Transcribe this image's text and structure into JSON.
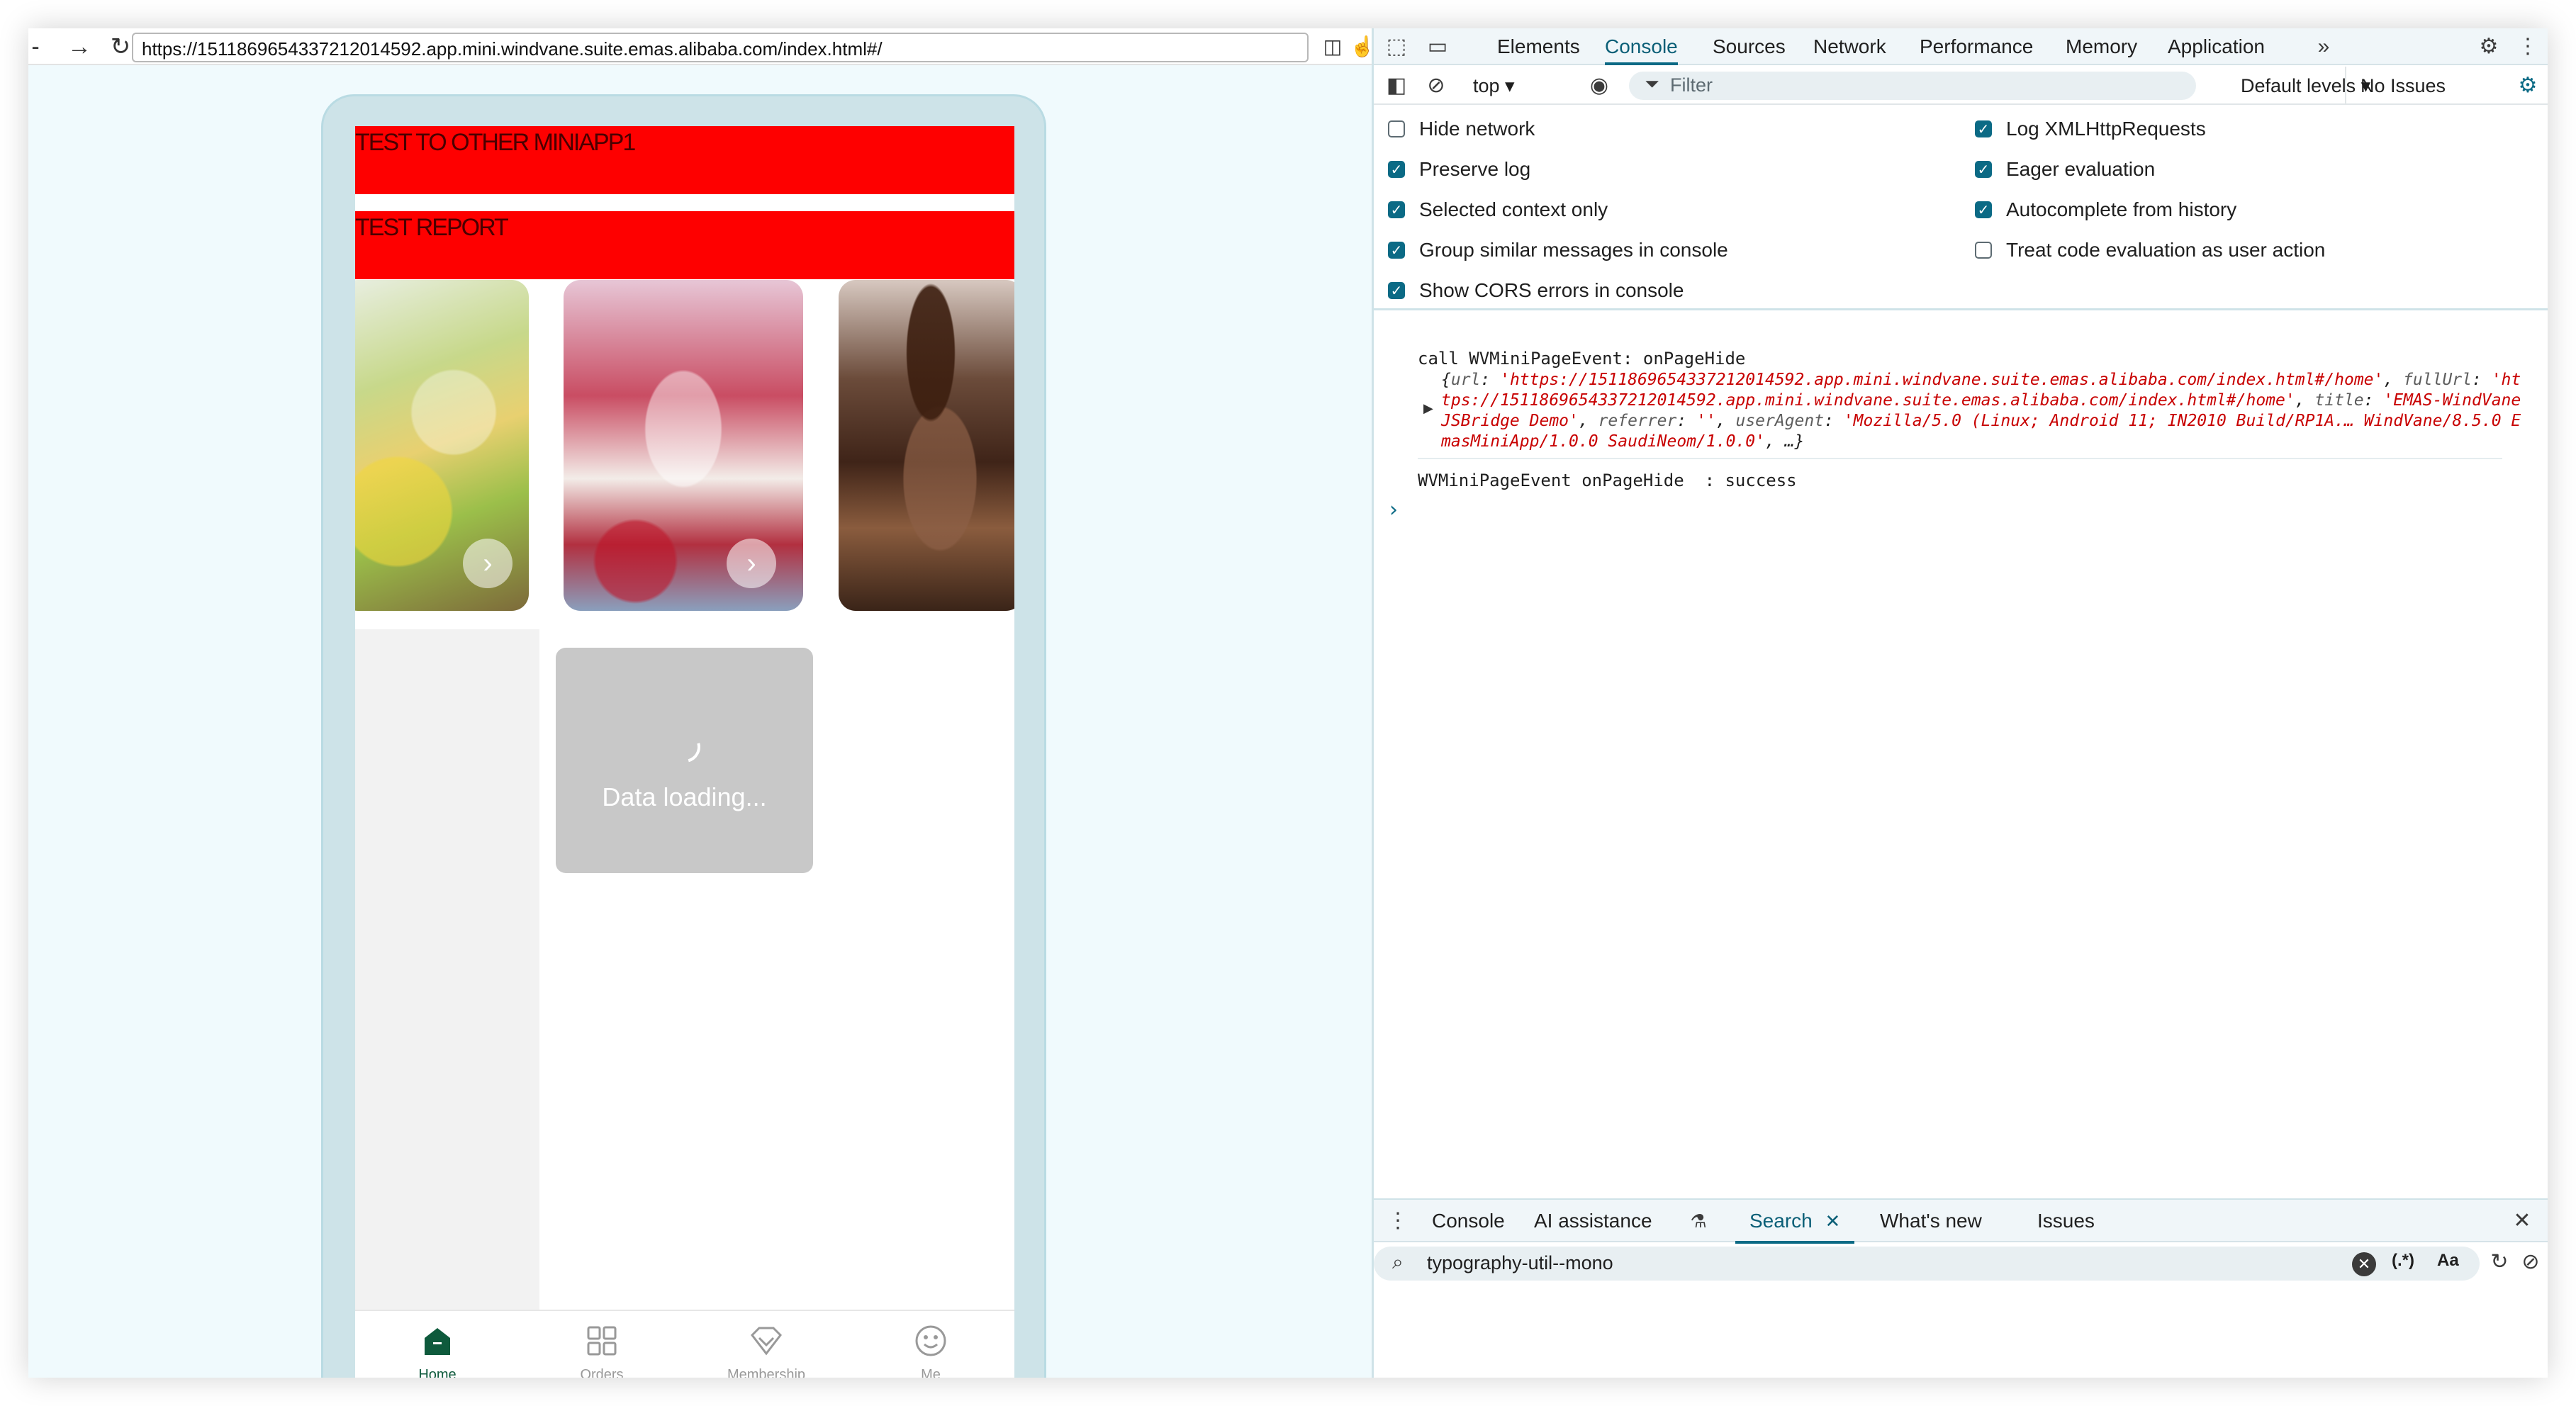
{
  "browser": {
    "url": "https://1511869654337212014592.app.mini.windvane.suite.emas.alibaba.com/index.html#/"
  },
  "miniapp": {
    "banner1": "TEST TO OTHER MINIAPP1",
    "banner2": "TEST REPORT",
    "loading_text": "Data loading...",
    "tabs": [
      "Home",
      "Orders",
      "Membership",
      "Me"
    ]
  },
  "devtools": {
    "tabs": [
      "Elements",
      "Console",
      "Sources",
      "Network",
      "Performance",
      "Memory",
      "Application"
    ],
    "active_tab": "Console",
    "context": "top ▾",
    "filter_placeholder": "Filter",
    "levels": "Default levels ▾",
    "issues": "No Issues",
    "options_left": [
      {
        "label": "Hide network",
        "checked": false
      },
      {
        "label": "Preserve log",
        "checked": true
      },
      {
        "label": "Selected context only",
        "checked": true
      },
      {
        "label": "Group similar messages in console",
        "checked": true
      },
      {
        "label": "Show CORS errors in console",
        "checked": true
      }
    ],
    "options_right": [
      {
        "label": "Log XMLHttpRequests",
        "checked": true
      },
      {
        "label": "Eager evaluation",
        "checked": true
      },
      {
        "label": "Autocomplete from history",
        "checked": true
      },
      {
        "label": "Treat code evaluation as user action",
        "checked": false
      }
    ],
    "log": {
      "line1": "call WVMiniPageEvent: onPageHide",
      "obj_url_key": "url",
      "obj_url_val": "'https://1511869654337212014592.app.mini.windvane.suite.emas.alibaba.com/index.html#/home'",
      "obj_fullurl_key": "fullUrl",
      "obj_fullurl_val": "'https://1511869654337212014592.app.mini.windvane.suite.emas.alibaba.com/index.html#/home'",
      "obj_title_key": "title",
      "obj_title_val": "'EMAS-WindVane JSBridge Demo'",
      "obj_referrer_key": "referrer",
      "obj_referrer_val": "''",
      "obj_ua_key": "userAgent",
      "obj_ua_val": "'Mozilla/5.0 (Linux; Android 11; IN2010 Build/RP1A.… WindVane/8.5.0 EmasMiniApp/1.0.0 SaudiNeom/1.0.0'",
      "obj_tail": "…}",
      "line2": "WVMiniPageEvent onPageHide  : success"
    },
    "drawer_tabs": [
      "Console",
      "AI assistance",
      "Search",
      "What's new",
      "Issues"
    ],
    "drawer_active": "Search",
    "search_value": "typography-util--mono",
    "search_regex": "(.*)",
    "search_case": "Aa"
  }
}
